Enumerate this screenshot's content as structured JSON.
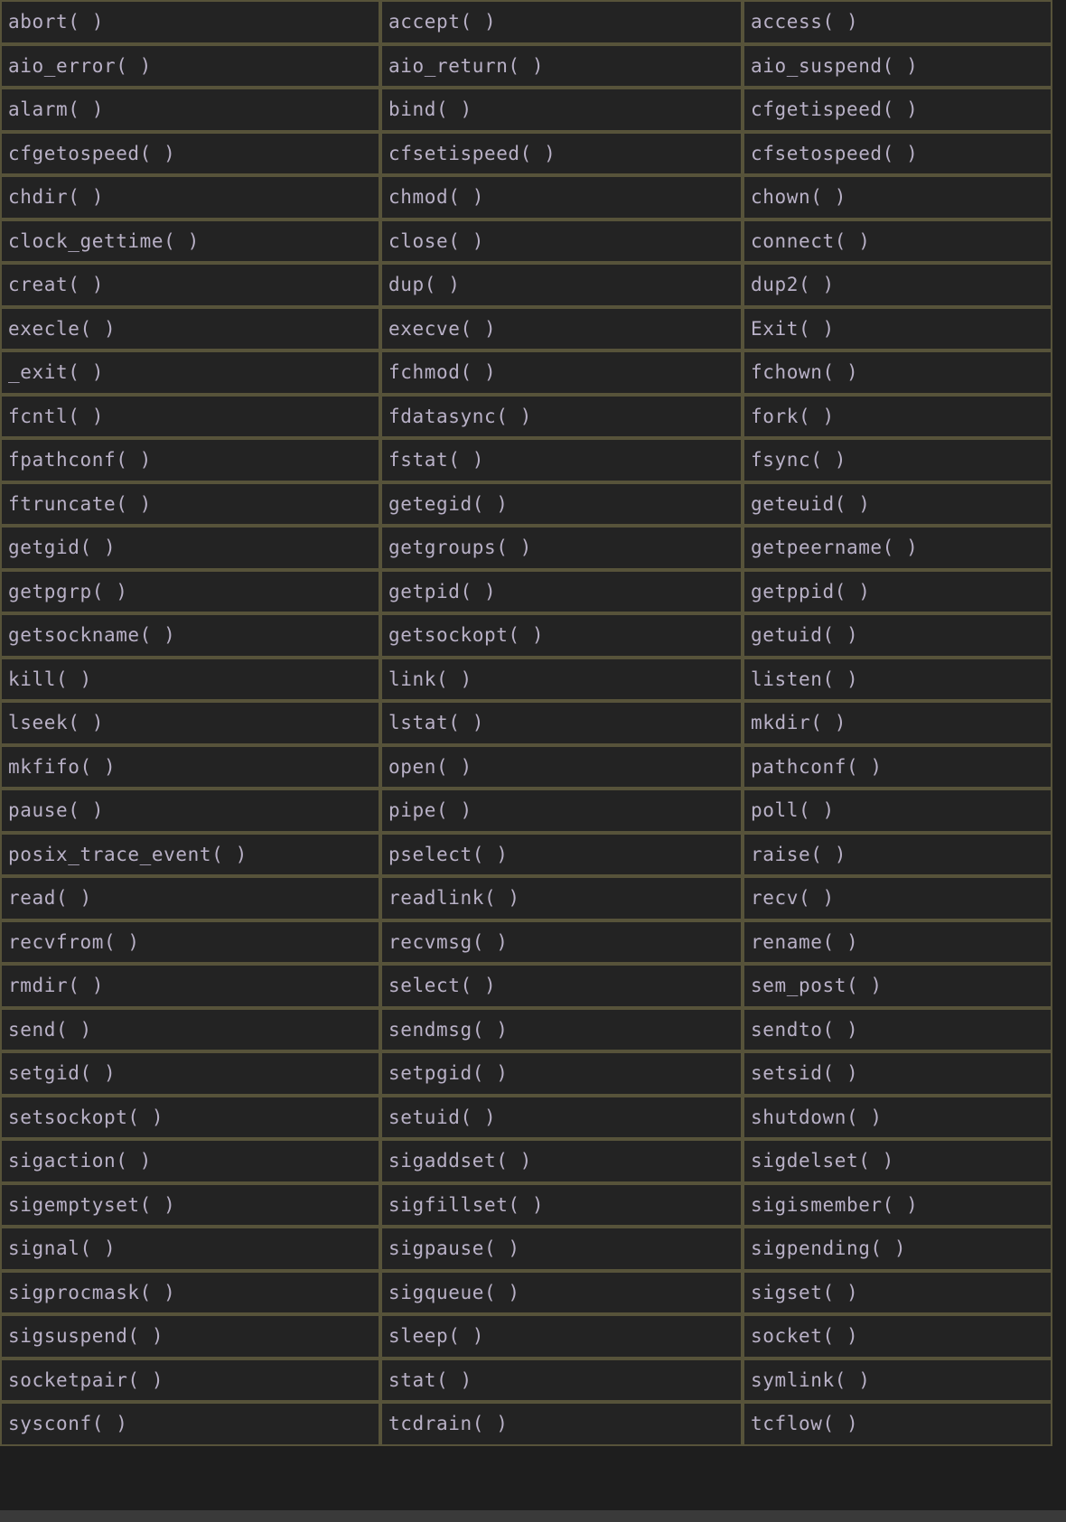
{
  "functions": [
    [
      "abort( )",
      "accept( )",
      "access( )"
    ],
    [
      "aio_error( )",
      "aio_return( )",
      "aio_suspend( )"
    ],
    [
      "alarm( )",
      "bind( )",
      "cfgetispeed( )"
    ],
    [
      "cfgetospeed( )",
      "cfsetispeed( )",
      "cfsetospeed( )"
    ],
    [
      "chdir( )",
      "chmod( )",
      "chown( )"
    ],
    [
      "clock_gettime( )",
      "close( )",
      "connect( )"
    ],
    [
      "creat( )",
      "dup( )",
      "dup2( )"
    ],
    [
      "execle( )",
      "execve( )",
      "Exit( )"
    ],
    [
      "_exit( )",
      "fchmod( )",
      "fchown( )"
    ],
    [
      "fcntl( )",
      "fdatasync( )",
      "fork( )"
    ],
    [
      "fpathconf( )",
      "fstat( )",
      "fsync( )"
    ],
    [
      "ftruncate( )",
      "getegid( )",
      "geteuid( )"
    ],
    [
      "getgid( )",
      "getgroups( )",
      "getpeername( )"
    ],
    [
      "getpgrp( )",
      "getpid( )",
      "getppid( )"
    ],
    [
      "getsockname( )",
      "getsockopt( )",
      "getuid( )"
    ],
    [
      "kill( )",
      "link( )",
      "listen( )"
    ],
    [
      "lseek( )",
      "lstat( )",
      "mkdir( )"
    ],
    [
      "mkfifo( )",
      "open( )",
      "pathconf( )"
    ],
    [
      "pause( )",
      "pipe( )",
      "poll( )"
    ],
    [
      "posix_trace_event( )",
      "pselect( )",
      "raise( )"
    ],
    [
      "read( )",
      "readlink( )",
      "recv( )"
    ],
    [
      "recvfrom( )",
      "recvmsg( )",
      "rename( )"
    ],
    [
      "rmdir( )",
      "select( )",
      "sem_post( )"
    ],
    [
      "send( )",
      "sendmsg( )",
      "sendto( )"
    ],
    [
      "setgid( )",
      "setpgid( )",
      "setsid( )"
    ],
    [
      "setsockopt( )",
      "setuid( )",
      "shutdown( )"
    ],
    [
      "sigaction( )",
      "sigaddset( )",
      "sigdelset( )"
    ],
    [
      "sigemptyset( )",
      "sigfillset( )",
      "sigismember( )"
    ],
    [
      "signal( )",
      "sigpause( )",
      "sigpending( )"
    ],
    [
      "sigprocmask( )",
      "sigqueue( )",
      "sigset( )"
    ],
    [
      "sigsuspend( )",
      "sleep( )",
      "socket( )"
    ],
    [
      "socketpair( )",
      "stat( )",
      "symlink( )"
    ],
    [
      "sysconf( )",
      "tcdrain( )",
      "tcflow( )"
    ]
  ],
  "colors": {
    "background": "#1e1e1e",
    "cell_background": "#232323",
    "cell_border": "#57533a",
    "text": "#b9b1c7",
    "bottom_bar": "#3a3a3a"
  }
}
